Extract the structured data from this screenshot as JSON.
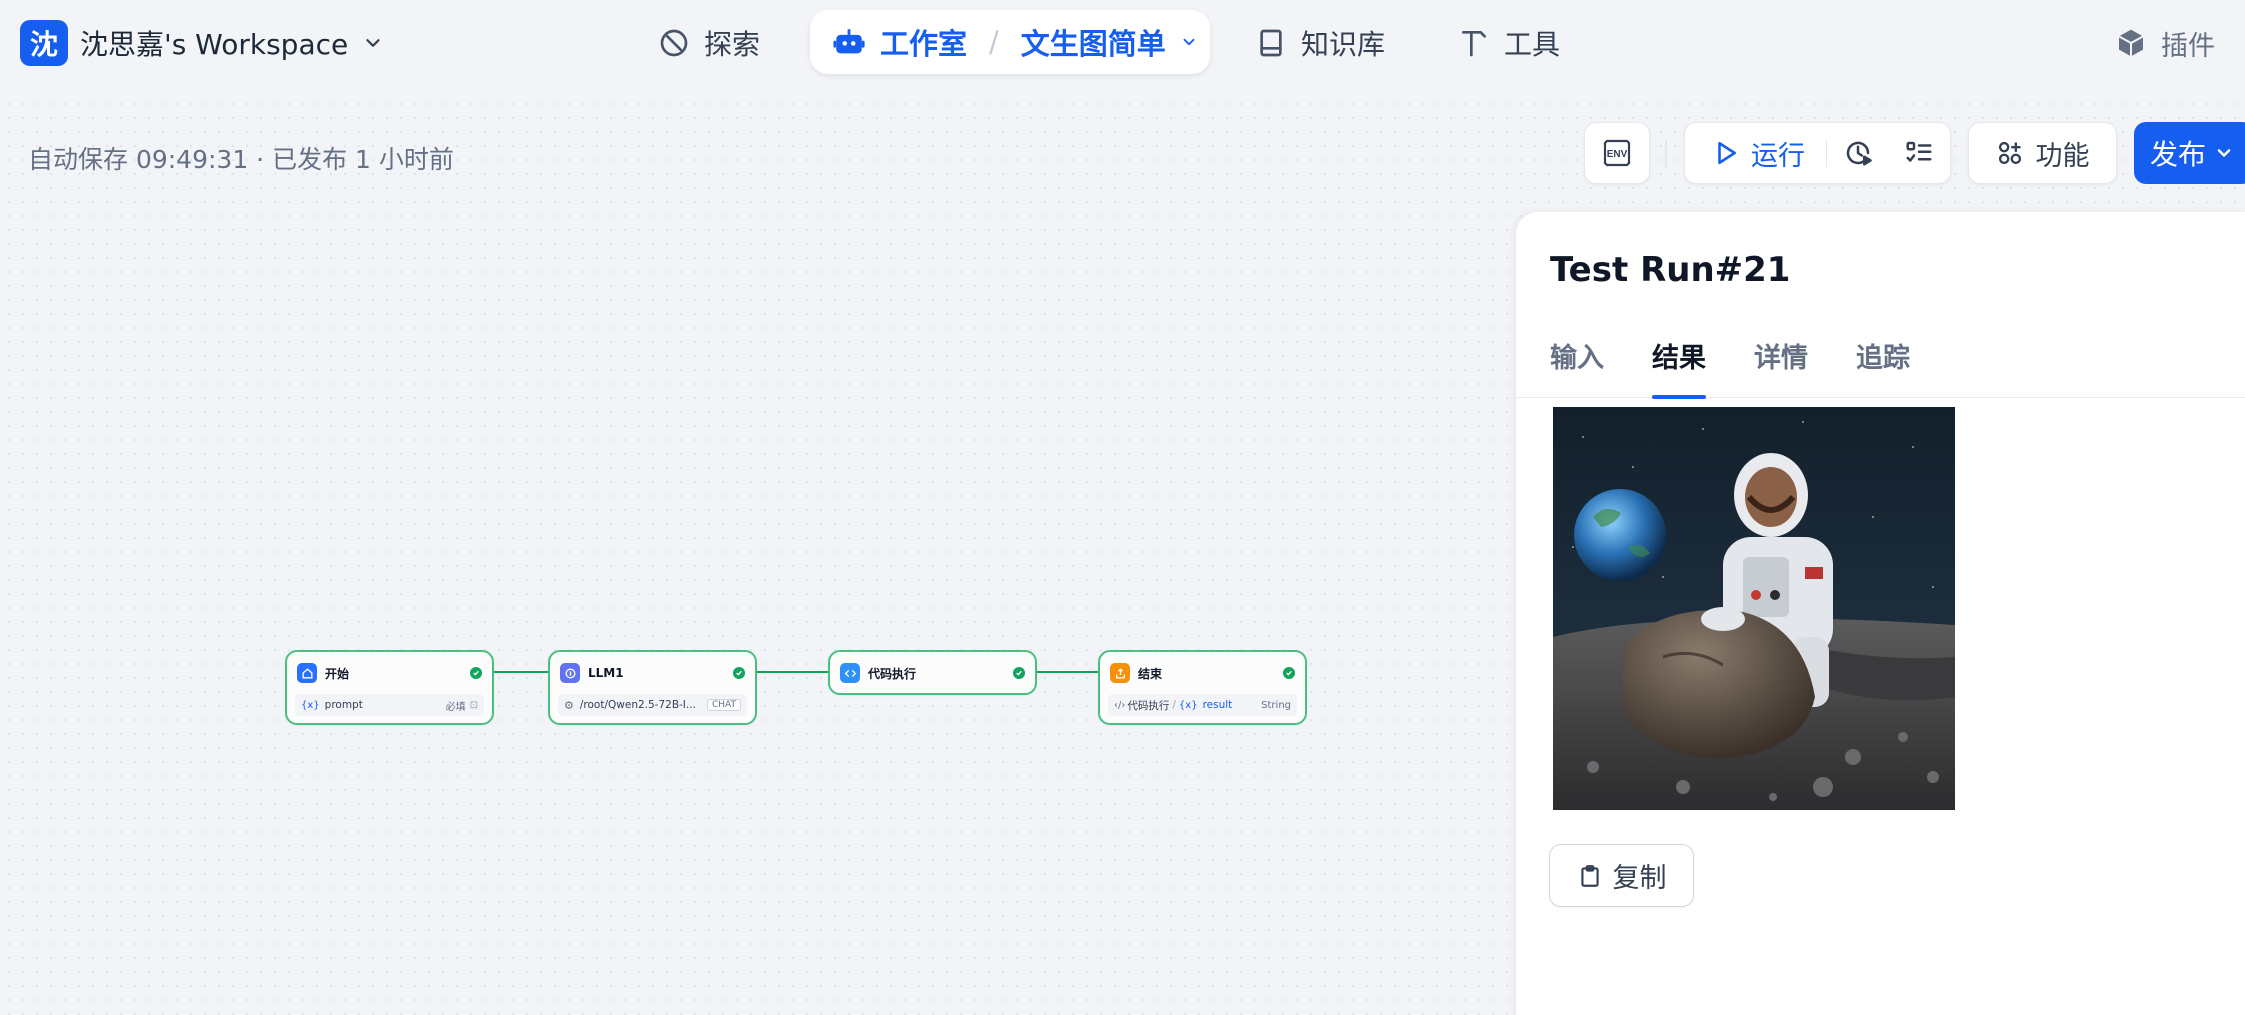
{
  "workspace": {
    "avatar_char": "沈",
    "name": "沈思嘉's Workspace"
  },
  "nav": {
    "explore": "探索",
    "studio": "工作室",
    "app_name": "文生图简单",
    "knowledge": "知识库",
    "tools": "工具",
    "plugins": "插件"
  },
  "canvas": {
    "autosave": "自动保存 09:49:31 · 已发布 1 小时前"
  },
  "toolbar": {
    "env_label": "ENV",
    "run": "运行",
    "features": "功能",
    "publish": "发布"
  },
  "nodes": [
    {
      "title": "开始",
      "icon": "home-icon",
      "color": "#2970ff",
      "row_left": "prompt",
      "row_right": "必填"
    },
    {
      "title": "LLM1",
      "icon": "llm-icon",
      "color": "#6172f3",
      "row_left": "/root/Qwen2.5-72B-I...",
      "row_right": "CHAT"
    },
    {
      "title": "代码执行",
      "icon": "code-icon",
      "color": "#2e90fa"
    },
    {
      "title": "结束",
      "icon": "end-icon",
      "color": "#f79009",
      "row_prefix": "代码执行",
      "row_left": "result",
      "row_right": "String"
    }
  ],
  "panel": {
    "title": "Test Run#21",
    "tabs": [
      "输入",
      "结果",
      "详情",
      "追踪"
    ],
    "active_tab": "结果",
    "result_image": "astronaut-on-moon-image",
    "copy": "复制"
  },
  "colors": {
    "accent": "#155eef",
    "success": "#12a35c",
    "node_border": "#4bbf7f"
  }
}
